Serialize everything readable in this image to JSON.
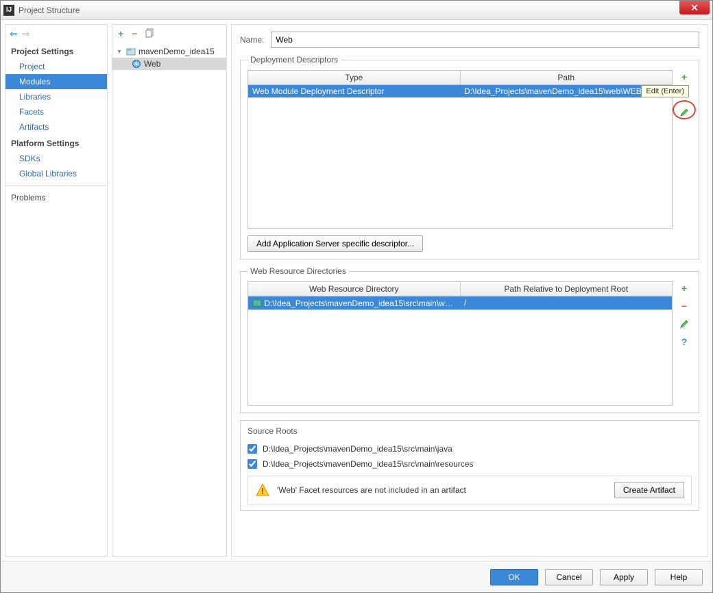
{
  "window": {
    "title": "Project Structure"
  },
  "sidebar": {
    "group1": {
      "header": "Project Settings",
      "items": [
        "Project",
        "Modules",
        "Libraries",
        "Facets",
        "Artifacts"
      ],
      "selected": 1
    },
    "group2": {
      "header": "Platform Settings",
      "items": [
        "SDKs",
        "Global Libraries"
      ]
    },
    "extra": [
      "Problems"
    ]
  },
  "tree": {
    "root": "mavenDemo_idea15",
    "child": "Web"
  },
  "name": {
    "label": "Name:",
    "value": "Web"
  },
  "depDesc": {
    "legend": "Deployment Descriptors",
    "cols": [
      "Type",
      "Path"
    ],
    "row": {
      "type": "Web Module Deployment Descriptor",
      "path": "D:\\Idea_Projects\\mavenDemo_idea15\\web\\WEB-INF..."
    },
    "tooltip": "Edit (Enter)",
    "addBtn": "Add Application Server specific descriptor..."
  },
  "webRes": {
    "legend": "Web Resource Directories",
    "cols": [
      "Web Resource Directory",
      "Path Relative to Deployment Root"
    ],
    "row": {
      "dir": "D:\\Idea_Projects\\mavenDemo_idea15\\src\\main\\we...",
      "rel": "/"
    }
  },
  "sourceRoots": {
    "legend": "Source Roots",
    "items": [
      "D:\\Idea_Projects\\mavenDemo_idea15\\src\\main\\java",
      "D:\\Idea_Projects\\mavenDemo_idea15\\src\\main\\resources"
    ]
  },
  "warning": {
    "text": "'Web' Facet resources are not included in an artifact",
    "btn": "Create Artifact"
  },
  "footer": {
    "ok": "OK",
    "cancel": "Cancel",
    "apply": "Apply",
    "help": "Help"
  }
}
